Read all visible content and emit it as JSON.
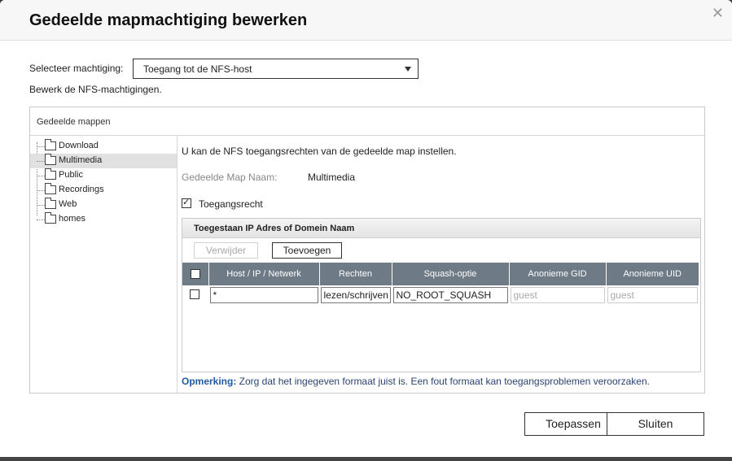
{
  "dialog": {
    "title": "Gedeelde mapmachtiging bewerken",
    "close_glyph": "✕"
  },
  "permission": {
    "label": "Selecteer machtiging:",
    "selected": "Toegang tot de NFS-host",
    "description": "Bewerk de NFS-machtigingen."
  },
  "panel": {
    "title": "Gedeelde mappen"
  },
  "tree": {
    "items": [
      {
        "label": "Download",
        "selected": false
      },
      {
        "label": "Multimedia",
        "selected": true
      },
      {
        "label": "Public",
        "selected": false
      },
      {
        "label": "Recordings",
        "selected": false
      },
      {
        "label": "Web",
        "selected": false
      },
      {
        "label": "homes",
        "selected": false
      }
    ]
  },
  "detail": {
    "info": "U kan de NFS toegangsrechten van de gedeelde map instellen.",
    "name_label": "Gedeelde Map Naam:",
    "name_value": "Multimedia",
    "access_label": "Toegangsrecht",
    "access_checked": true
  },
  "allowed": {
    "title": "Toegestaan IP Adres of Domein Naam",
    "delete_label": "Verwijder",
    "add_label": "Toevoegen",
    "columns": [
      "Host / IP / Netwerk",
      "Rechten",
      "Squash-optie",
      "Anonieme GID",
      "Anonieme UID"
    ],
    "rows": [
      {
        "host": "*",
        "rights": "lezen/schrijven",
        "squash": "NO_ROOT_SQUASH",
        "gid": "guest",
        "uid": "guest"
      }
    ]
  },
  "note": {
    "label": "Opmerking:",
    "text": " Zorg dat het ingegeven formaat juist is. Een fout formaat kan toegangsproblemen veroorzaken."
  },
  "buttons": {
    "apply": "Toepassen",
    "close": "Sluiten"
  },
  "colors": {
    "table_header": "#6f7a87",
    "note_text": "#2b4470",
    "tree_selected": "#e1e1e1"
  }
}
